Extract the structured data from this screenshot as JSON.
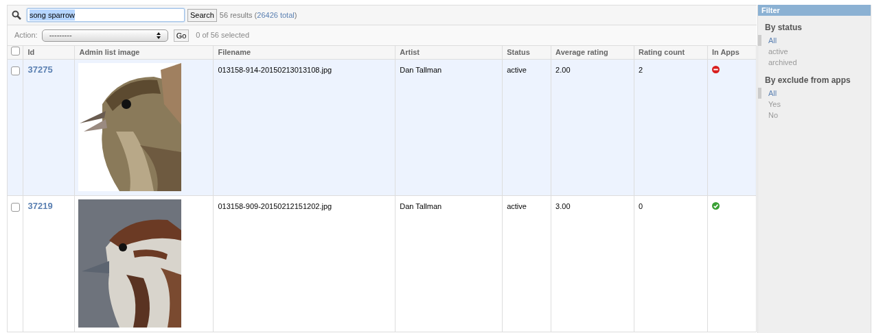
{
  "search": {
    "value": "song sparrow",
    "button": "Search",
    "results": "56 results (",
    "total": "26426 total",
    "results_end": ")"
  },
  "actions": {
    "label": "Action:",
    "value": "---------",
    "go": "Go",
    "selected_count": "0 of 56 selected"
  },
  "table": {
    "select_all_checked": false,
    "columns": [
      "Id",
      "Admin list image",
      "Filename",
      "Artist",
      "Status",
      "Average rating",
      "Rating count",
      "In Apps"
    ],
    "rows": [
      {
        "checked": false,
        "id": "37275",
        "filename": "013158-914-20150213013108.jpg",
        "artist": "Dan Tallman",
        "status": "active",
        "average_rating": "2.00",
        "rating_count": "2",
        "in_apps": false
      },
      {
        "checked": false,
        "id": "37219",
        "filename": "013158-909-20150212151202.jpg",
        "artist": "Dan Tallman",
        "status": "active",
        "average_rating": "3.00",
        "rating_count": "0",
        "in_apps": true
      }
    ]
  },
  "filter": {
    "title": "Filter",
    "groups": [
      {
        "title": "By status",
        "items": [
          {
            "label": "All",
            "selected": true
          },
          {
            "label": "active",
            "selected": false
          },
          {
            "label": "archived",
            "selected": false
          }
        ]
      },
      {
        "title": "By exclude from apps",
        "items": [
          {
            "label": "All",
            "selected": true
          },
          {
            "label": "Yes",
            "selected": false
          },
          {
            "label": "No",
            "selected": false
          }
        ]
      }
    ]
  }
}
